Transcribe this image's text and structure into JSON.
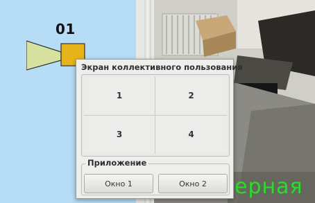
{
  "map": {
    "camera_label": "01",
    "camera_icon": "camera-icon"
  },
  "video": {
    "overlay_text": "ерная",
    "overlay_color": "#2bdc2b"
  },
  "dialog": {
    "title": "Экран коллективного пользования",
    "grid_cells": [
      "1",
      "2",
      "3",
      "4"
    ],
    "app_section_label": "Приложение",
    "buttons": [
      "Окно 1",
      "Окно 2"
    ]
  }
}
